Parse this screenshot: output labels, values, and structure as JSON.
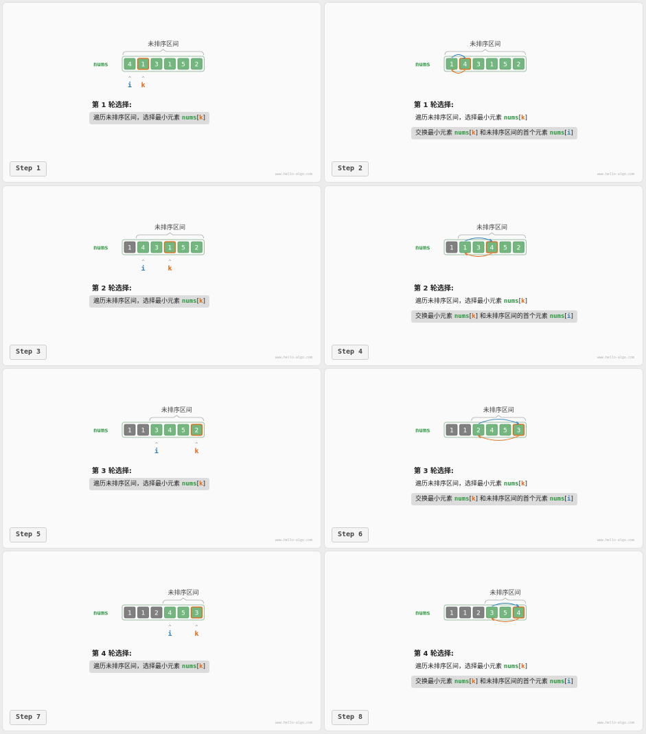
{
  "watermark": "www.hello-algo.com",
  "labels": {
    "unsorted": "未排序区间",
    "nums": "nums",
    "i": "i",
    "k": "k",
    "round_prefix": "第",
    "round_suffix": "轮选择:",
    "traverse": "遍历未排序区间，选择最小元素",
    "swap_a": "交换最小元素",
    "swap_b": "和未排序区间的首个元素",
    "nums_code": "nums",
    "lb": "[",
    "rb": "]"
  },
  "colors": {
    "sorted": "#808080",
    "unsorted": "#73b77f",
    "accent_green": "#2b9a3e",
    "accent_orange": "#e4670f",
    "accent_blue": "#2a7fbd"
  },
  "steps": [
    {
      "label": "Step 1",
      "round": "1",
      "array": [
        "4",
        "1",
        "3",
        "1",
        "5",
        "2"
      ],
      "sorted": 0,
      "i": 0,
      "k": 1,
      "swap": false
    },
    {
      "label": "Step 2",
      "round": "1",
      "array": [
        "1",
        "4",
        "3",
        "1",
        "5",
        "2"
      ],
      "sorted": 0,
      "i": 0,
      "k": 1,
      "swap": true
    },
    {
      "label": "Step 3",
      "round": "2",
      "array": [
        "1",
        "4",
        "3",
        "1",
        "5",
        "2"
      ],
      "sorted": 1,
      "i": 1,
      "k": 3,
      "swap": false
    },
    {
      "label": "Step 4",
      "round": "2",
      "array": [
        "1",
        "1",
        "3",
        "4",
        "5",
        "2"
      ],
      "sorted": 1,
      "i": 1,
      "k": 3,
      "swap": true
    },
    {
      "label": "Step 5",
      "round": "3",
      "array": [
        "1",
        "1",
        "3",
        "4",
        "5",
        "2"
      ],
      "sorted": 2,
      "i": 2,
      "k": 5,
      "swap": false
    },
    {
      "label": "Step 6",
      "round": "3",
      "array": [
        "1",
        "1",
        "2",
        "4",
        "5",
        "3"
      ],
      "sorted": 2,
      "i": 2,
      "k": 5,
      "swap": true
    },
    {
      "label": "Step 7",
      "round": "4",
      "array": [
        "1",
        "1",
        "2",
        "4",
        "5",
        "3"
      ],
      "sorted": 3,
      "i": 3,
      "k": 5,
      "swap": false
    },
    {
      "label": "Step 8",
      "round": "4",
      "array": [
        "1",
        "1",
        "2",
        "3",
        "5",
        "4"
      ],
      "sorted": 3,
      "i": 3,
      "k": 5,
      "swap": true
    }
  ]
}
